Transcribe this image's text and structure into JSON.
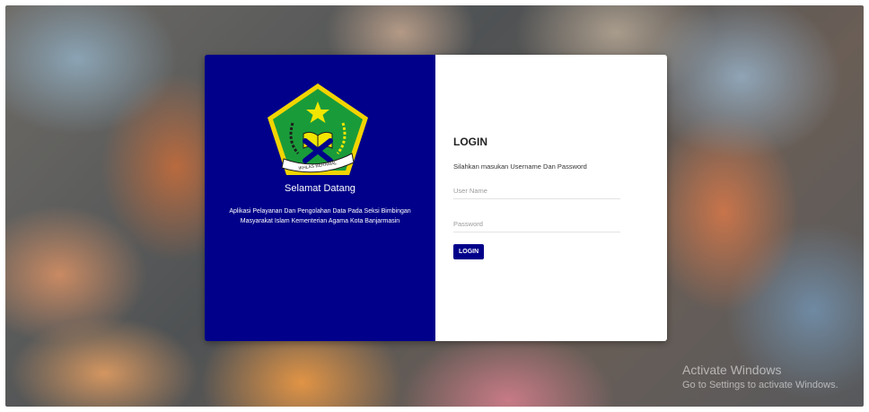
{
  "branding": {
    "welcome": "Selamat Datang",
    "description": "Aplikasi Pelayanan Dan Pengolahan Data Pada Seksi Bimbingan Masyarakat Islam Kementerian Agama Kota Banjarmasin",
    "emblem_ribbon": "IKHLAS BERAMAL",
    "panel_color": "#00008a",
    "emblem_colors": {
      "border": "#f2d400",
      "field": "#1a9b3a",
      "star": "#f2e600"
    }
  },
  "login": {
    "title": "LOGIN",
    "subtitle": "Silahkan masukan Username Dan Password",
    "username_placeholder": "User Name",
    "password_placeholder": "Password",
    "button_label": "LOGIN"
  },
  "watermark": {
    "line1": "Activate Windows",
    "line2": "Go to Settings to activate Windows."
  }
}
